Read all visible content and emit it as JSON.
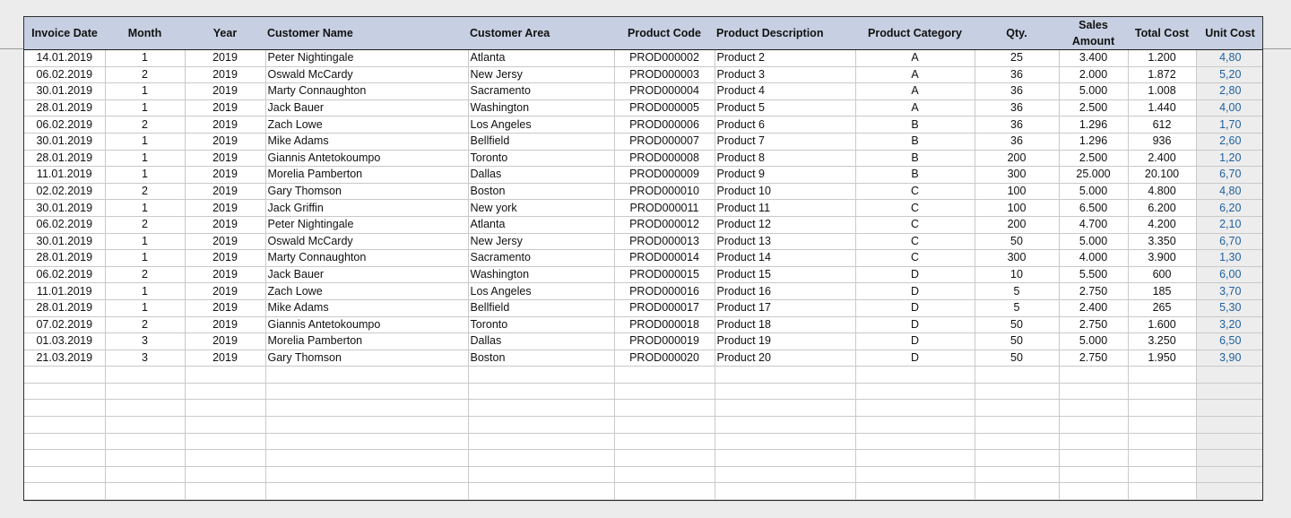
{
  "headers": {
    "invoice_date": "Invoice Date",
    "month": "Month",
    "year": "Year",
    "customer_name": "Customer Name",
    "customer_area": "Customer Area",
    "product_code": "Product Code",
    "product_description": "Product Description",
    "product_category": "Product Category",
    "qty": "Qty.",
    "sales_amount_line1": "Sales",
    "sales_amount_line2": "Amount",
    "total_cost": "Total Cost",
    "unit_cost": "Unit Cost"
  },
  "rows": [
    [
      "14.01.2019",
      "1",
      "2019",
      "Peter Nightingale",
      "Atlanta",
      "PROD000002",
      "Product 2",
      "A",
      "25",
      "3.400",
      "1.200",
      "4,80"
    ],
    [
      "06.02.2019",
      "2",
      "2019",
      "Oswald McCardy",
      "New Jersy",
      "PROD000003",
      "Product 3",
      "A",
      "36",
      "2.000",
      "1.872",
      "5,20"
    ],
    [
      "30.01.2019",
      "1",
      "2019",
      "Marty Connaughton",
      "Sacramento",
      "PROD000004",
      "Product 4",
      "A",
      "36",
      "5.000",
      "1.008",
      "2,80"
    ],
    [
      "28.01.2019",
      "1",
      "2019",
      "Jack Bauer",
      "Washington",
      "PROD000005",
      "Product 5",
      "A",
      "36",
      "2.500",
      "1.440",
      "4,00"
    ],
    [
      "06.02.2019",
      "2",
      "2019",
      "Zach Lowe",
      "Los Angeles",
      "PROD000006",
      "Product 6",
      "B",
      "36",
      "1.296",
      "612",
      "1,70"
    ],
    [
      "30.01.2019",
      "1",
      "2019",
      "Mike Adams",
      "Bellfield",
      "PROD000007",
      "Product 7",
      "B",
      "36",
      "1.296",
      "936",
      "2,60"
    ],
    [
      "28.01.2019",
      "1",
      "2019",
      "Giannis Antetokoumpo",
      "Toronto",
      "PROD000008",
      "Product 8",
      "B",
      "200",
      "2.500",
      "2.400",
      "1,20"
    ],
    [
      "11.01.2019",
      "1",
      "2019",
      "Morelia Pamberton",
      "Dallas",
      "PROD000009",
      "Product 9",
      "B",
      "300",
      "25.000",
      "20.100",
      "6,70"
    ],
    [
      "02.02.2019",
      "2",
      "2019",
      "Gary Thomson",
      "Boston",
      "PROD000010",
      "Product 10",
      "C",
      "100",
      "5.000",
      "4.800",
      "4,80"
    ],
    [
      "30.01.2019",
      "1",
      "2019",
      "Jack Griffin",
      "New york",
      "PROD000011",
      "Product 11",
      "C",
      "100",
      "6.500",
      "6.200",
      "6,20"
    ],
    [
      "06.02.2019",
      "2",
      "2019",
      "Peter Nightingale",
      "Atlanta",
      "PROD000012",
      "Product 12",
      "C",
      "200",
      "4.700",
      "4.200",
      "2,10"
    ],
    [
      "30.01.2019",
      "1",
      "2019",
      "Oswald McCardy",
      "New Jersy",
      "PROD000013",
      "Product 13",
      "C",
      "50",
      "5.000",
      "3.350",
      "6,70"
    ],
    [
      "28.01.2019",
      "1",
      "2019",
      "Marty Connaughton",
      "Sacramento",
      "PROD000014",
      "Product 14",
      "C",
      "300",
      "4.000",
      "3.900",
      "1,30"
    ],
    [
      "06.02.2019",
      "2",
      "2019",
      "Jack Bauer",
      "Washington",
      "PROD000015",
      "Product 15",
      "D",
      "10",
      "5.500",
      "600",
      "6,00"
    ],
    [
      "11.01.2019",
      "1",
      "2019",
      "Zach Lowe",
      "Los Angeles",
      "PROD000016",
      "Product 16",
      "D",
      "5",
      "2.750",
      "185",
      "3,70"
    ],
    [
      "28.01.2019",
      "1",
      "2019",
      "Mike Adams",
      "Bellfield",
      "PROD000017",
      "Product 17",
      "D",
      "5",
      "2.400",
      "265",
      "5,30"
    ],
    [
      "07.02.2019",
      "2",
      "2019",
      "Giannis Antetokoumpo",
      "Toronto",
      "PROD000018",
      "Product 18",
      "D",
      "50",
      "2.750",
      "1.600",
      "3,20"
    ],
    [
      "01.03.2019",
      "3",
      "2019",
      "Morelia Pamberton",
      "Dallas",
      "PROD000019",
      "Product 19",
      "D",
      "50",
      "5.000",
      "3.250",
      "6,50"
    ],
    [
      "21.03.2019",
      "3",
      "2019",
      "Gary Thomson",
      "Boston",
      "PROD000020",
      "Product 20",
      "D",
      "50",
      "2.750",
      "1.950",
      "3,90"
    ]
  ],
  "colors": {
    "header_bg": "#c7d0e2",
    "unit_cost_text": "#1f5f9f",
    "unit_cost_bg": "#ededed",
    "grid": "#c9c9c9"
  }
}
